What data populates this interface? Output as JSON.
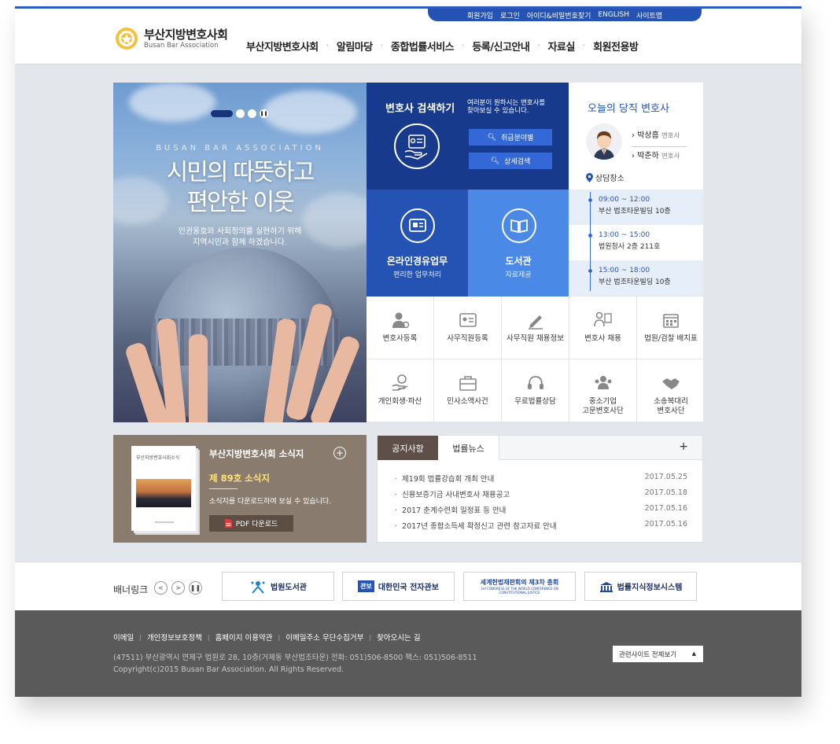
{
  "utility": [
    "회원가입",
    "로그인",
    "아이디&비밀번호찾기",
    "ENGLISH",
    "사이트맵"
  ],
  "logo": {
    "korean": "부산지방변호사회",
    "english": "Busan Bar Association"
  },
  "gnb": [
    "부산지방변호사회",
    "알림마당",
    "종합법률서비스",
    "등록/신고안내",
    "자료실",
    "회원전용방"
  ],
  "hero": {
    "tagline": "BUSAN BAR ASSOCIATION",
    "title_line1": "시민의 따뜻하고",
    "title_line2": "편안한 이웃",
    "sub_line1": "인권옹호와 사회정의를 실현하기 위해",
    "sub_line2": "지역시민과 함께 하겠습니다."
  },
  "lawyer_search": {
    "title": "변호사 검색하기",
    "desc_line1": "여러분이 원하시는 변호사를",
    "desc_line2": "찾아보실 수 있습니다.",
    "btn_field": "취급분야별",
    "btn_detail": "상세검색"
  },
  "duty": {
    "title": "오늘의 당직 변호사",
    "lawyer1": "박상흠",
    "lawyer2": "박춘하",
    "role": "변호사",
    "place_label": "상담장소",
    "slots": [
      {
        "time": "09:00 ~ 12:00",
        "place": "부산 법조타운빌딩 10층"
      },
      {
        "time": "13:00 ~ 15:00",
        "place": "법원청사 2층 211호"
      },
      {
        "time": "15:00 ~ 18:00",
        "place": "부산 법조타운빌딩 10층"
      }
    ]
  },
  "features": {
    "online_title": "온라인경유업무",
    "online_sub": "편리한 업무처리",
    "library_title": "도서관",
    "library_sub": "자료제공"
  },
  "quick_menu": [
    [
      "변호사등록"
    ],
    [
      "사무직원등록"
    ],
    [
      "사무직원 채용정보"
    ],
    [
      "변호사 채용"
    ],
    [
      "법원/검찰 배치표"
    ],
    [
      "개인회생·파산"
    ],
    [
      "민사소액사건"
    ],
    [
      "무료법률상담"
    ],
    [
      "중소기업",
      "고문변호사단"
    ],
    [
      "소송복대리",
      "변호사단"
    ]
  ],
  "newsletter": {
    "book_title": "부산지방변호사회소식",
    "title": "부산지방변호사회 소식지",
    "issue": "제 89호 소식지",
    "desc": "소식지를 다운로드하여 보실 수 있습니다.",
    "download": "PDF 다운로드"
  },
  "notice": {
    "tab_active": "공지사항",
    "tab_inactive": "법률뉴스",
    "more": "+",
    "items": [
      {
        "title": "제19회 법률강습회 개최 안내",
        "date": "2017.05.25"
      },
      {
        "title": "신용보증기금 사내변호사 채용공고",
        "date": "2017.05.18"
      },
      {
        "title": "2017 춘계수련회 일정표 등 안내",
        "date": "2017.05.16"
      },
      {
        "title": "2017년 종합소득세 확정신고 관련 참고자료 안내",
        "date": "2017.05.16"
      }
    ]
  },
  "banner": {
    "label": "배너링크",
    "items": [
      "법원도서관",
      "대한민국 전자관보",
      "세계헌법재판회의 제3차 총회",
      "법률지식정보시스템"
    ],
    "gwanbo_badge": "관보",
    "wccj_sub": "3rd CONGRESS OF THE WORLD CONFERENCE ON CONSTITUTIONAL JUSTICE"
  },
  "footer": {
    "links": [
      "이메일",
      "개인정보보호정책",
      "홈페이지 이용약관",
      "이메일주소 무단수집거부",
      "찾아오시는 길"
    ],
    "address": "(47511) 부산광역시 연제구 법원로 28, 10층(거제동 부산법조타운) 전화: 051)506-8500 팩스: 051)506-8511",
    "copyright": "Copyright(c)2015 Busan Bar Association. All Rights Reserved.",
    "related": "관련사이트 전체보기"
  },
  "colors": {
    "primary": "#2553b4",
    "navy": "#173a8c",
    "sky": "#4a8ae6",
    "brown": "#8a7b6f",
    "footer": "#5a5a5a"
  }
}
